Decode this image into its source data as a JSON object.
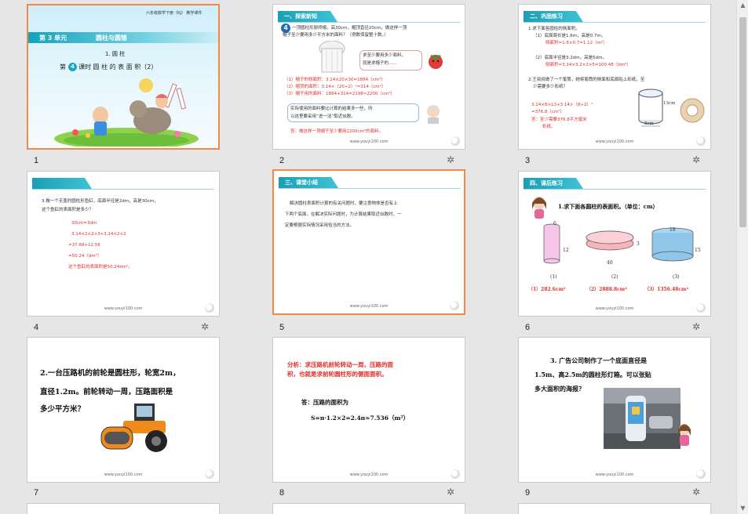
{
  "footer_url": "www.youyi100.com",
  "slides": {
    "s1": {
      "number": "1",
      "top_right": "六年级数学下册（RJ）    教学课件",
      "unit": "第 3 单元",
      "unit_title": "圆柱与圆锥",
      "section": "1. 圆 柱",
      "lesson_a": "第",
      "lesson_num": "4",
      "lesson_b": "课时  圆 柱 的 表 面 积（2）"
    },
    "s2": {
      "number": "2",
      "header": "一、探索新知",
      "problem_num": "4",
      "problem": "一顶圆柱形厨师帽，高30cm，帽顶直径20cm，做这样一顶",
      "problem2": "帽子至少要用多少平方米的面料？（得数保留整十数。）",
      "bubble1": "求至少要用多少面料，",
      "bubble2": "就是求帽子的……",
      "a1": "（1）帽子的侧面积：3.14×20×30=1884（cm²）",
      "a2": "（2）帽顶的面积：3.14×（20÷2）²=314（cm²）",
      "a3": "（3）帽子用的面料：1884+314=2198≈2200（cm²）",
      "note1": "实际使用的面料要比计算的结果多一些，所",
      "note2": "以这里要采用“进一法”取近似数。",
      "answer": "答：做这样一顶帽子至少要用2200cm²的面料。"
    },
    "s3": {
      "number": "3",
      "header": "二、巩固练习",
      "q1": "1.求下面各圆柱的侧面积。",
      "q1a": "（1）底面周长是1.6m，高是0.7m。",
      "q1a_ans": "侧面积=1.6×0.7=1.12（m²）",
      "q1b": "（2）底面半径是3.2dm，高是5dm。",
      "q1b_ans": "侧面积=3.14×3.2×2×5=100.48（dm²）",
      "q2": "2.王叔叔做了一个笔筒，她将笔筒的侧面和底面贴上彩纸，至",
      "q2b": "少需要多少彩纸？",
      "calc1": "3.14×8×13+3.14×（8÷2）²",
      "calc2": "=376.8（cm²）",
      "ans1": "答：至少需要376.8平方厘米",
      "ans2": "彩纸。",
      "dim_h": "13cm",
      "dim_d": "8cm"
    },
    "s4": {
      "number": "4",
      "q": "3.做一个无盖的圆柱形鱼缸，底面半径是2dm，高是30cm，",
      "q2": "这个鱼缸的表面积是多少？",
      "l1": "30cm=3dm",
      "l2": "3.14×2×2×3+3.14×2×2",
      "l3": "=37.68+12.56",
      "l4": "=50.24（dm²）",
      "l5": "这个鱼缸的表面积是50.24dm²。"
    },
    "s5": {
      "number": "5",
      "header": "三、课堂小结",
      "p1": "解决圆柱表面积计算的有关问题时，要注意物体是否有上",
      "p2": "下两个底面，在解决实际问题时，为计算结果取近似数时，一",
      "p3": "定要根据实际情况采用恰当的方法。"
    },
    "s6": {
      "number": "6",
      "header": "四、课后练习",
      "q": "1.求下面各圆柱的表面积。（单位：cm）",
      "c1_top": "6",
      "c1_side": "12",
      "c2_side": "3",
      "c2_bottom": "40",
      "c3_top": "18",
      "c3_side": "15",
      "lab1": "(1)",
      "lab2": "(2)",
      "lab3": "(3)",
      "ans1": "（1）282.6cm²",
      "ans2": "（2）2888.8cm²",
      "ans3": "（3）1356.48cm²"
    },
    "s7": {
      "number": "7",
      "l1": "2.一台压路机的前轮是圆柱形，轮宽2m，",
      "l2": "直径1.2m。前轮转动一周，压路面积是",
      "l3": "多少平方米？"
    },
    "s8": {
      "number": "8",
      "r1": "分析：求压路机前轮转动一周，压路的面",
      "r2": "积，也就是求前轮圆柱形的侧面面积。",
      "a": "答：压路的面积为",
      "f": "S=π·1.2×2=2.4π≈7.536（m²）"
    },
    "s9": {
      "number": "9",
      "l1": "3. 广告公司制作了一个底面直径是",
      "l2": "1.5m、高2.5m的圆柱形灯箱。可以张贴",
      "l3": "多大面积的海报？"
    }
  }
}
